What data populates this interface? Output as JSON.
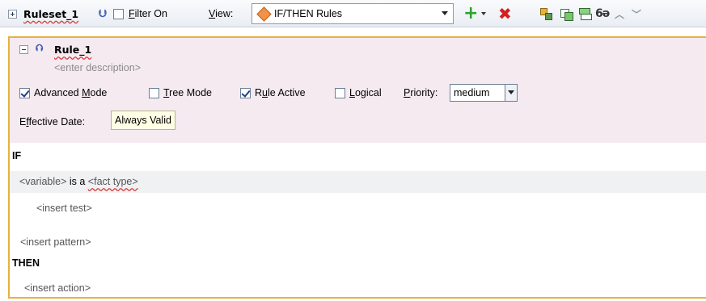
{
  "toolbar": {
    "ruleset_name": "Ruleset_1",
    "filter_label": "Filter On",
    "filter_checked": false,
    "view_label": "View:",
    "view_value": "IF/THEN Rules",
    "icons": [
      "expand-icon",
      "double-chevron-icon",
      "diamond-rule-icon",
      "add-icon",
      "delete-icon",
      "tree-icon",
      "copy-icon",
      "paste-icon",
      "glasses-icon",
      "move-up-icon",
      "move-down-icon"
    ]
  },
  "rule": {
    "name": "Rule_1",
    "description_placeholder": "<enter description>",
    "advanced_mode_label": "Advanced Mode",
    "advanced_mode_checked": true,
    "tree_mode_label": "Tree Mode",
    "tree_mode_checked": false,
    "rule_active_label": "Rule Active",
    "rule_active_checked": true,
    "logical_label": "Logical",
    "logical_checked": false,
    "priority_label": "Priority:",
    "priority_value": "medium",
    "effective_date_label": "Effective Date:",
    "effective_date_value": "Always Valid"
  },
  "body": {
    "if_keyword": "IF",
    "pattern_variable": "<variable>",
    "pattern_is_a": "is a",
    "pattern_fact_type": "<fact type>",
    "insert_test": "<insert test>",
    "insert_pattern": "<insert pattern>",
    "then_keyword": "THEN",
    "insert_action": "<insert action>"
  },
  "colors": {
    "panel_border": "#e6b13d",
    "rule_header_bg": "#f5eaf0",
    "effective_date_bg": "#ffffe6",
    "add_green": "#2da32d",
    "delete_red": "#d51f1f"
  }
}
